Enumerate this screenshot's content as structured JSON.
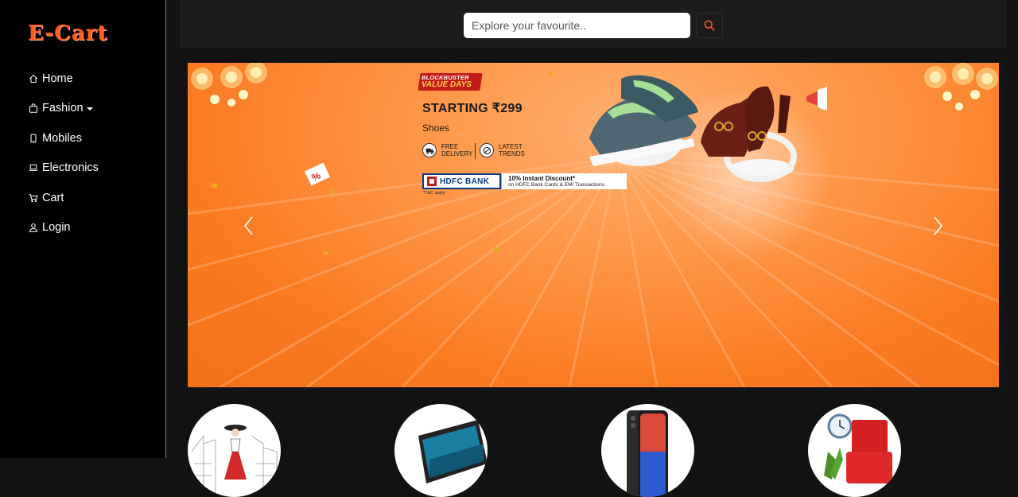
{
  "brand": {
    "name": "E-Cart"
  },
  "nav": {
    "home": "Home",
    "fashion": "Fashion",
    "mobiles": "Mobiles",
    "electronics": "Electronics",
    "cart": "Cart",
    "login": "Login"
  },
  "search": {
    "placeholder": "Explore your favourite..",
    "button_icon": "search-icon"
  },
  "banner": {
    "badge_top": "BLOCKBUSTER",
    "badge_main": "VALUE DAYS",
    "headline": "STARTING ₹299",
    "category": "Shoes",
    "feature1": "FREE DELIVERY",
    "feature2": "LATEST TRENDS",
    "bank_name": "HDFC BANK",
    "bank_offer": "10% Instant Discount*",
    "bank_offer_sub": "on HDFC Bank Cards & EMI Transactions",
    "tnc": "*T&C apply"
  },
  "colors": {
    "accent": "#ff5a1f",
    "banner": "#f97b22",
    "sidebar": "#000000",
    "background": "#121212"
  },
  "categories": [
    "fashion-image",
    "electronics-image",
    "mobiles-image",
    "furniture-image"
  ]
}
